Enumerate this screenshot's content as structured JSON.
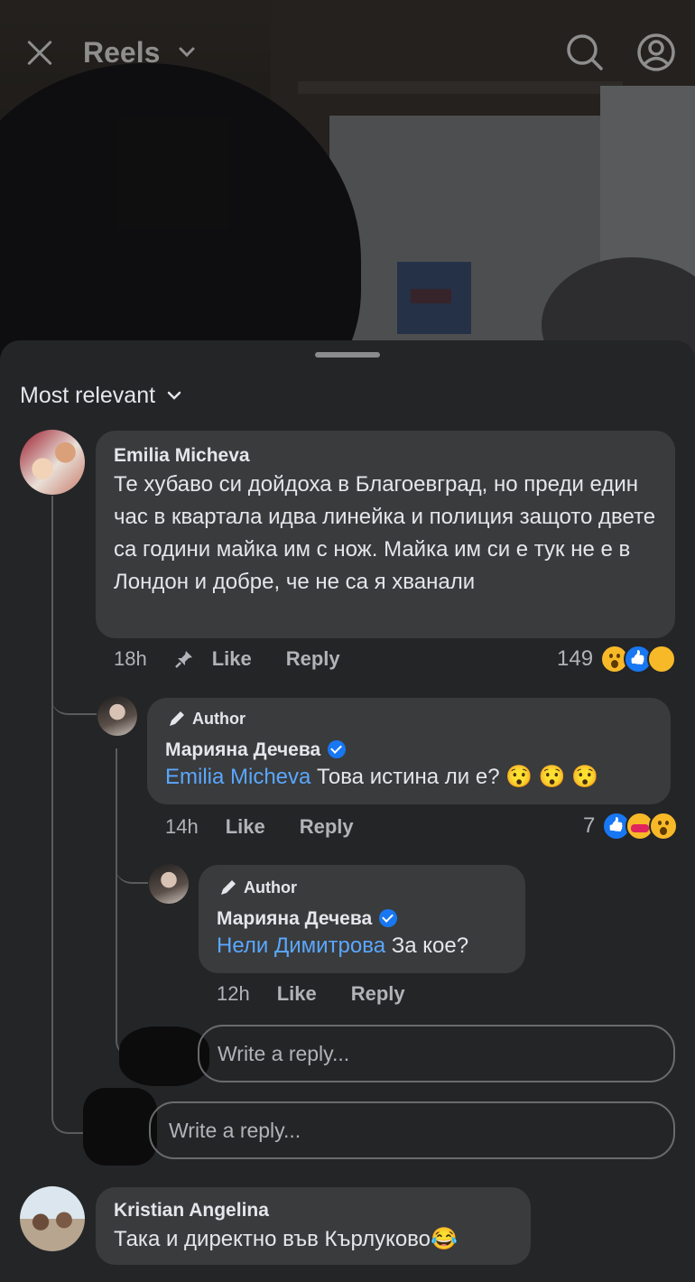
{
  "topbar": {
    "title": "Reels"
  },
  "sort": {
    "label": "Most relevant"
  },
  "comments": [
    {
      "author": "Emilia Micheva",
      "text": "Те хубаво си дойдоха в Благоевград, но преди един час в квартала идва линейка и полиция защото двете са години майка им с нож. Майка им си е тук не е в Лондон и добре, че не са я хванали",
      "time": "18h",
      "like": "Like",
      "reply": "Reply",
      "reaction_count": "149",
      "replies": [
        {
          "badge": "Author",
          "author": "Марияна Дечева",
          "mention": "Emilia Micheva",
          "text": " Това истина ли е? 😯 😯 😯",
          "time": "14h",
          "like": "Like",
          "reply": "Reply",
          "reaction_count": "7"
        },
        {
          "badge": "Author",
          "author": "Марияна Дечева",
          "mention": "Нели Димитрова",
          "text": " За кое?",
          "time": "12h",
          "like": "Like",
          "reply": "Reply"
        }
      ],
      "reply_placeholder_inner": "Write a reply...",
      "reply_placeholder_outer": "Write a reply..."
    },
    {
      "author": "Kristian Angelina",
      "text": "Така и директно във Кърлуково😂"
    }
  ],
  "colors": {
    "sheet_bg": "#242527",
    "bubble_bg": "#3a3b3c",
    "mention": "#5aa7ff",
    "verified": "#1877f2"
  }
}
